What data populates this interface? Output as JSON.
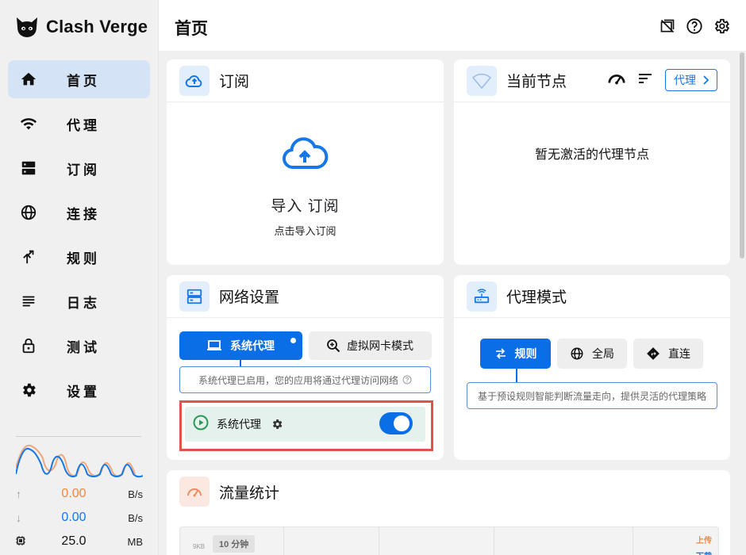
{
  "app": {
    "name": "Clash Verge"
  },
  "sidebar": {
    "items": [
      {
        "label": "首页",
        "icon": "home-icon",
        "active": true
      },
      {
        "label": "代理",
        "icon": "wifi-icon",
        "active": false
      },
      {
        "label": "订阅",
        "icon": "dns-icon",
        "active": false
      },
      {
        "label": "连接",
        "icon": "globe-icon",
        "active": false
      },
      {
        "label": "规则",
        "icon": "fork-icon",
        "active": false
      },
      {
        "label": "日志",
        "icon": "list-icon",
        "active": false
      },
      {
        "label": "测试",
        "icon": "lock-icon",
        "active": false
      },
      {
        "label": "设置",
        "icon": "gear-icon",
        "active": false
      }
    ],
    "stats": {
      "upload": {
        "value": "0.00",
        "unit": "B/s",
        "color": "#f0883e"
      },
      "download": {
        "value": "0.00",
        "unit": "B/s",
        "color": "#1677e6"
      },
      "memory": {
        "value": "25.0",
        "unit": "MB"
      }
    }
  },
  "header": {
    "title": "首页",
    "icons": [
      "sidebar-toggle-icon",
      "help-icon",
      "settings-icon"
    ]
  },
  "subscription": {
    "title": "订阅",
    "import_title": "导入 订阅",
    "import_sub": "点击导入订阅"
  },
  "current_node": {
    "title": "当前节点",
    "proxy_button": "代理",
    "empty_text": "暂无激活的代理节点"
  },
  "network": {
    "title": "网络设置",
    "tabs": [
      {
        "label": "系统代理",
        "active": true
      },
      {
        "label": "虚拟网卡模式",
        "active": false
      }
    ],
    "description": "系统代理已启用，您的应用将通过代理访问网络",
    "switch_label": "系统代理",
    "switch_on": true
  },
  "proxy_mode": {
    "title": "代理模式",
    "modes": [
      {
        "label": "规则",
        "active": true
      },
      {
        "label": "全局",
        "active": false
      },
      {
        "label": "直连",
        "active": false
      }
    ],
    "description": "基于预设规则智能判断流量走向，提供灵活的代理策略"
  },
  "traffic": {
    "title": "流量统计",
    "range": "10 分钟",
    "y_label": "9KB",
    "legend_up": "上传",
    "legend_down": "下载"
  },
  "colors": {
    "accent": "#0a6fe6",
    "upload": "#f0883e",
    "download": "#1677e6",
    "highlight": "#e0524f"
  }
}
